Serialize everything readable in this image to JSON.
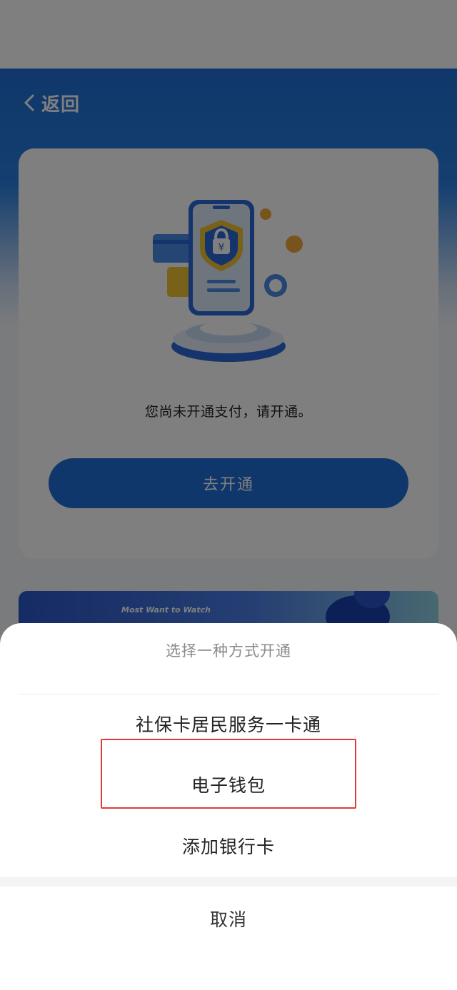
{
  "header": {
    "back_label": "返回"
  },
  "card": {
    "notice": "您尚未开通支付，请开通。",
    "button_label": "去开通"
  },
  "banner": {
    "tag": "Most Want to Watch"
  },
  "sheet": {
    "title": "选择一种方式开通",
    "options": [
      {
        "label": "社保卡居民服务一卡通"
      },
      {
        "label": "电子钱包",
        "highlighted": true
      },
      {
        "label": "添加银行卡"
      }
    ],
    "cancel_label": "取消",
    "highlight_color": "#e03a3a"
  },
  "colors": {
    "brand_blue": "#1f6fd6",
    "overlay": "rgba(0,0,0,0.5)"
  },
  "icons": [
    "chevron-left-icon",
    "phone-shield-illustration"
  ]
}
